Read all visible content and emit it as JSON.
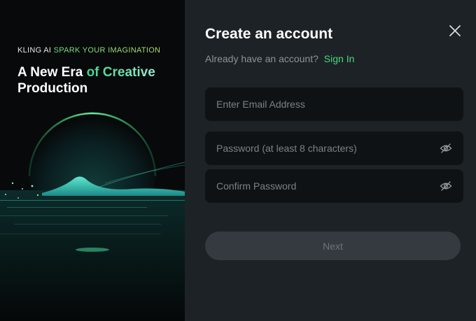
{
  "left_panel": {
    "brand": "KLING AI",
    "tagline": "SPARK YOUR IMAGINATION",
    "headline_part1": "A New Era ",
    "headline_accent": "of Creative",
    "headline_part2": "Production",
    "headline_tail": ""
  },
  "form": {
    "title": "Create an account",
    "signin_prompt": "Already have an account?",
    "signin_link": "Sign In",
    "email": {
      "placeholder": "Enter Email Address",
      "value": ""
    },
    "password": {
      "placeholder": "Password (at least 8 characters)",
      "value": ""
    },
    "confirm_password": {
      "placeholder": "Confirm Password",
      "value": ""
    },
    "next_label": "Next"
  },
  "icons": {
    "close": "close-icon",
    "password_toggle": "eye-icon",
    "confirm_toggle": "eye-icon"
  },
  "colors": {
    "accent_green": "#48d87b",
    "panel_bg": "#1d2227",
    "input_bg": "#0f1215",
    "button_disabled_bg": "#353a40"
  }
}
